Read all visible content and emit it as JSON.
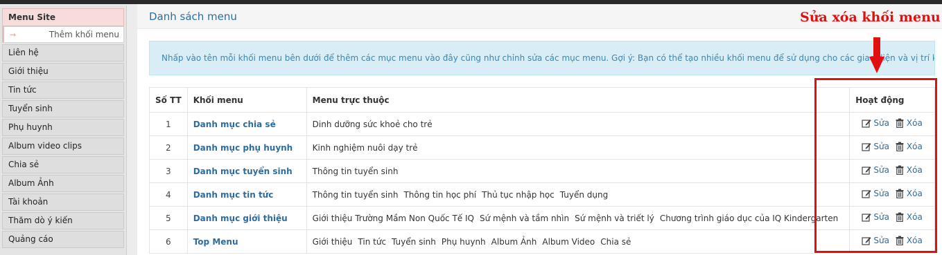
{
  "sidebar": {
    "header": "Menu Site",
    "sub_item": {
      "arrow": "→",
      "label": "Thêm khối menu"
    },
    "items": [
      {
        "label": "Liên hệ"
      },
      {
        "label": "Giới thiệu"
      },
      {
        "label": "Tin tức"
      },
      {
        "label": "Tuyển sinh"
      },
      {
        "label": "Phụ huynh"
      },
      {
        "label": "Album video clips"
      },
      {
        "label": "Chia sẻ"
      },
      {
        "label": "Album Ảnh"
      },
      {
        "label": "Tài khoản"
      },
      {
        "label": "Thăm dò ý kiến"
      },
      {
        "label": "Quảng cáo"
      }
    ]
  },
  "main": {
    "title": "Danh sách menu",
    "info": "Nhấp vào tên mỗi khối menu bên dưới để thêm các mục menu vào đây cũng như chỉnh sửa các mục menu. Gợi ý: Bạn có thể tạo nhiều khối menu để sử dụng cho các giao diện và vị trí khác nhau."
  },
  "table": {
    "headers": {
      "stt": "Số TT",
      "block": "Khối menu",
      "submenu": "Menu trực thuộc",
      "actions": "Hoạt động"
    },
    "edit_label": "Sửa",
    "delete_label": "Xóa",
    "rows": [
      {
        "num": "1",
        "name": "Danh mục chia sẻ",
        "items": [
          "Dinh dưỡng sức khoẻ cho trẻ"
        ]
      },
      {
        "num": "2",
        "name": "Danh mục phụ huynh",
        "items": [
          "Kinh nghiệm nuôi dạy trẻ"
        ]
      },
      {
        "num": "3",
        "name": "Danh mục tuyển sinh",
        "items": [
          "Thông tin tuyển sinh"
        ]
      },
      {
        "num": "4",
        "name": "Danh mục tin tức",
        "items": [
          "Thông tin tuyển sinh",
          "Thông tin học phí",
          "Thủ tục nhập học",
          "Tuyển dụng"
        ]
      },
      {
        "num": "5",
        "name": "Danh mục giới thiệu",
        "items": [
          "Giới thiệu Trường Mầm Non Quốc Tế IQ",
          "Sứ mệnh và tầm nhìn",
          "Sứ mệnh và triết lý",
          "Chương trình giáo dục của IQ Kindergarten"
        ]
      },
      {
        "num": "6",
        "name": "Top Menu",
        "items": [
          "Giới thiệu",
          "Tin tức",
          "Tuyển sinh",
          "Phụ huynh",
          "Album Ảnh",
          "Album Video",
          "Chia sẻ"
        ]
      }
    ]
  },
  "annotation": {
    "text": "Sửa xóa khối menu",
    "color": "#e01010"
  },
  "colors": {
    "link": "#2c6da0",
    "info_bg": "#d9edf7",
    "accent_red": "#e01010"
  },
  "icons": {
    "edit": "edit-icon",
    "delete": "trash-icon",
    "arrow": "down-arrow-icon"
  }
}
